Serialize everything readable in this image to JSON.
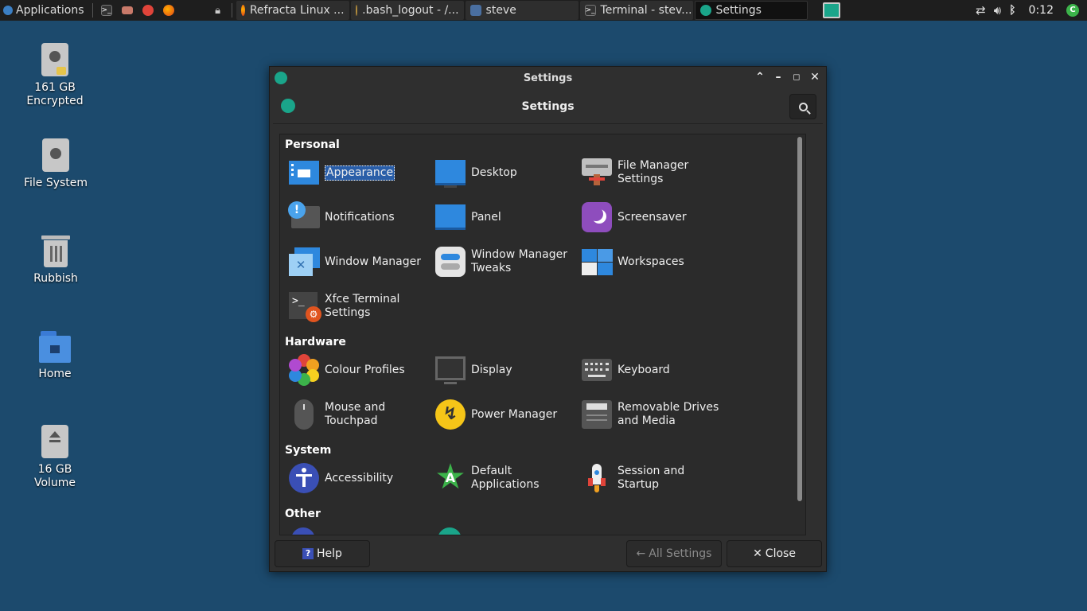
{
  "panel": {
    "applications_label": "Applications",
    "tasks": [
      {
        "title": "Refracta Linux ...",
        "icon": "firefox-icon"
      },
      {
        "title": ".bash_logout - /...",
        "icon": "text-editor-icon"
      },
      {
        "title": "steve",
        "icon": "folder-icon"
      },
      {
        "title": "Terminal - stev...",
        "icon": "terminal-icon"
      },
      {
        "title": "Settings",
        "icon": "settings-icon"
      }
    ],
    "clock": "0:12"
  },
  "desktop": {
    "icons": [
      {
        "label": "161 GB\nEncrypted"
      },
      {
        "label": "File System"
      },
      {
        "label": "Rubbish"
      },
      {
        "label": "Home"
      },
      {
        "label": "16 GB\nVolume"
      }
    ]
  },
  "window": {
    "title": "Settings",
    "header_title": "Settings",
    "sections": {
      "personal": "Personal",
      "hardware": "Hardware",
      "system": "System",
      "other": "Other"
    },
    "items": {
      "appearance": "Appearance",
      "desktop": "Desktop",
      "file_manager": "File Manager\nSettings",
      "notifications": "Notifications",
      "panel": "Panel",
      "screensaver": "Screensaver",
      "window_manager": "Window Manager",
      "wm_tweaks": "Window Manager\nTweaks",
      "workspaces": "Workspaces",
      "xfce_terminal": "Xfce Terminal\nSettings",
      "colour_profiles": "Colour Profiles",
      "display": "Display",
      "keyboard": "Keyboard",
      "mouse": "Mouse and\nTouchpad",
      "power": "Power Manager",
      "removable": "Removable Drives\nand Media",
      "accessibility": "Accessibility",
      "default_apps": "Default\nApplications",
      "session": "Session and\nStartup"
    },
    "buttons": {
      "help": "Help",
      "all_settings": "All Settings",
      "close": "Close"
    }
  }
}
